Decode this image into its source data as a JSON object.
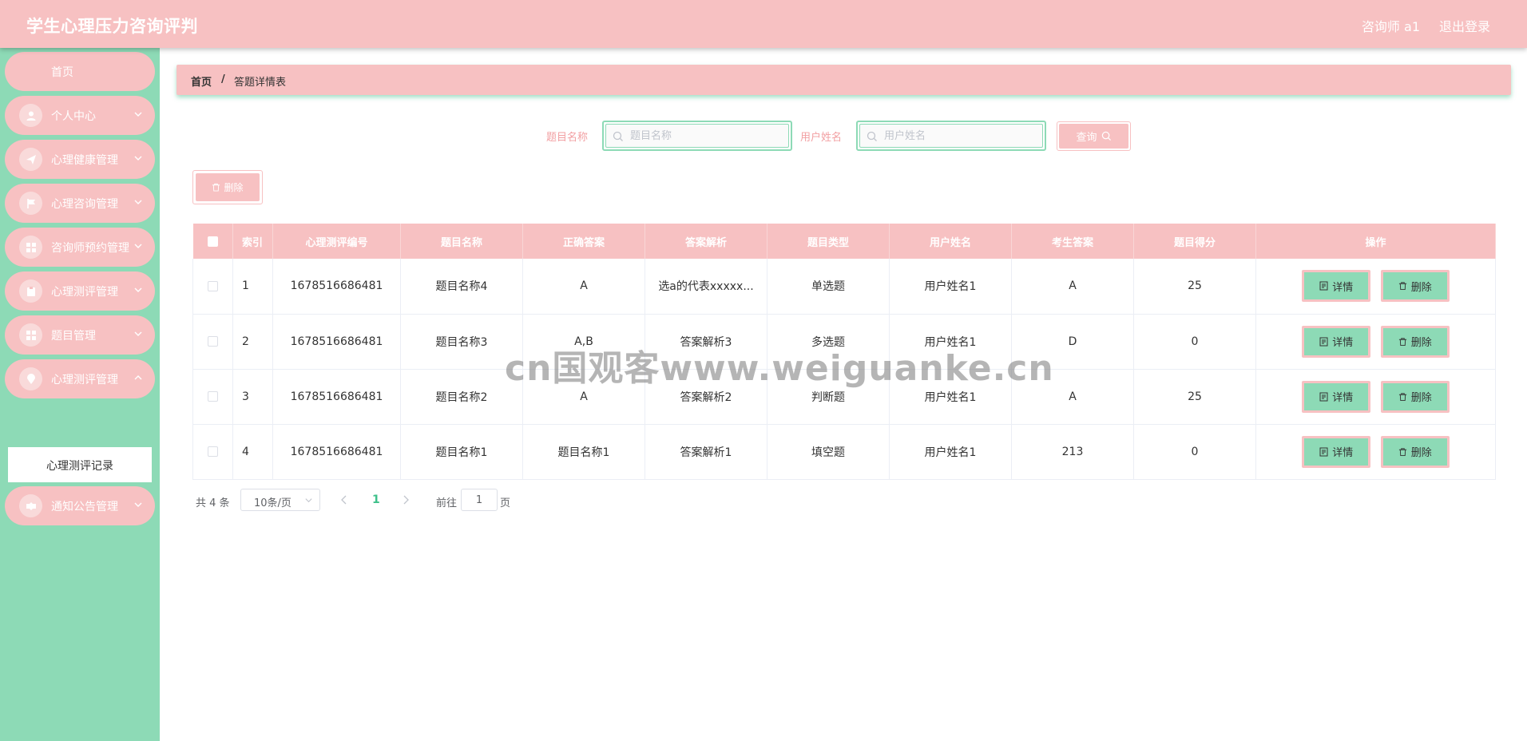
{
  "header": {
    "title": "学生心理压力咨询评判",
    "user": "咨询师 a1",
    "logout": "退出登录"
  },
  "sidebar": {
    "home": "首页",
    "items": [
      {
        "label": "个人中心",
        "icon": "user-icon"
      },
      {
        "label": "心理健康管理",
        "icon": "send-icon"
      },
      {
        "label": "心理咨询管理",
        "icon": "flag-icon"
      },
      {
        "label": "咨询师预约管理",
        "icon": "grid-icon"
      },
      {
        "label": "心理测评管理",
        "icon": "clipboard-icon"
      },
      {
        "label": "题目管理",
        "icon": "grid-icon"
      },
      {
        "label": "心理测评管理",
        "icon": "location-icon"
      },
      {
        "label": "通知公告管理",
        "icon": "ticket-icon"
      }
    ],
    "submenu_active": "心理测评记录"
  },
  "breadcrumb": {
    "home": "首页",
    "separator": "/",
    "current": "答题详情表"
  },
  "search": {
    "title_label": "题目名称",
    "title_placeholder": "题目名称",
    "user_label": "用户姓名",
    "user_placeholder": "用户姓名",
    "query_button": "查询"
  },
  "toolbar": {
    "delete_label": "删除"
  },
  "table": {
    "columns": [
      "索引",
      "心理测评编号",
      "题目名称",
      "正确答案",
      "答案解析",
      "题目类型",
      "用户姓名",
      "考生答案",
      "题目得分",
      "操作"
    ],
    "rows": [
      [
        "1",
        "1678516686481",
        "题目名称4",
        "A",
        "选a的代表xxxxx...",
        "单选题",
        "用户姓名1",
        "A",
        "25"
      ],
      [
        "2",
        "1678516686481",
        "题目名称3",
        "A,B",
        "答案解析3",
        "多选题",
        "用户姓名1",
        "D",
        "0"
      ],
      [
        "3",
        "1678516686481",
        "题目名称2",
        "A",
        "答案解析2",
        "判断题",
        "用户姓名1",
        "A",
        "25"
      ],
      [
        "4",
        "1678516686481",
        "题目名称1",
        "题目名称1",
        "答案解析1",
        "填空题",
        "用户姓名1",
        "213",
        "0"
      ]
    ],
    "detail_label": "详情",
    "delete_label": "删除"
  },
  "pagination": {
    "total": "共 4 条",
    "page_size": "10条/页",
    "current_page": "1",
    "goto_label": "前往",
    "goto_value": "1",
    "page_suffix": "页"
  },
  "watermark": "cn国观客www.weiguanke.cn",
  "colors": {
    "pink": "#f7c1c2",
    "green": "#8ddab6",
    "active_page": "#3ec08a"
  }
}
